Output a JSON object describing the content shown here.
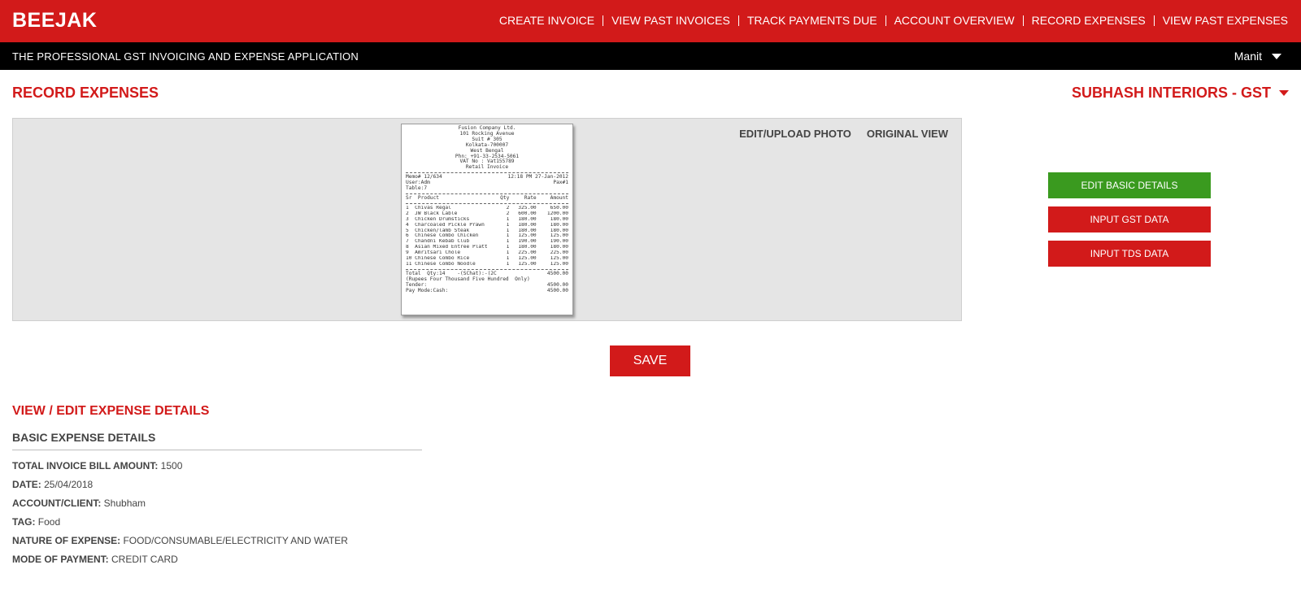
{
  "header": {
    "brand": "BEEJAK",
    "nav": [
      "CREATE INVOICE",
      "VIEW PAST INVOICES",
      "TRACK PAYMENTS DUE",
      "ACCOUNT OVERVIEW",
      "RECORD EXPENSES",
      "VIEW PAST EXPENSES"
    ],
    "tagline": "THE PROFESSIONAL GST INVOICING AND EXPENSE APPLICATION",
    "user": "Manit"
  },
  "page": {
    "title": "RECORD EXPENSES",
    "company": "SUBHASH INTERIORS - GST"
  },
  "photo": {
    "edit_upload": "EDIT/UPLOAD PHOTO",
    "original_view": "ORIGINAL VIEW",
    "receipt": {
      "header_lines": [
        "Fusion Company Ltd.",
        "101 Rocking Avenue",
        "Suit # 305",
        "Kolkata-700007",
        "West Bengal",
        "Phn: +91-33-2534-5061",
        "VAT No : Vat155789",
        "Retail Invoice"
      ],
      "memo": "Memo# 12/634",
      "datetime": "12:18 PM 27-Jan-2012",
      "user": "User:Adm",
      "station": "Pax#1",
      "table": "Table:7",
      "columns": [
        "Sr  Product",
        "Qty",
        "Rate",
        "Amount"
      ],
      "items": [
        [
          "1  Chivas Regal",
          "2",
          "325.00",
          "650.00"
        ],
        [
          "2  JW Black Lable",
          "2",
          "600.00",
          "1200.00"
        ],
        [
          "3  Chicken Drumsticks",
          "1",
          "180.00",
          "180.00"
        ],
        [
          "4  Charcoaled Pickle Prawn",
          "1",
          "180.00",
          "180.00"
        ],
        [
          "5  Chicken/lamb Steak",
          "1",
          "180.00",
          "180.00"
        ],
        [
          "6  Chinese Combo Chicken",
          "1",
          "125.00",
          "125.00"
        ],
        [
          "7  Chandni Kebab Club",
          "1",
          "190.00",
          "190.00"
        ],
        [
          "8  Asian Mixed Entree Platt",
          "1",
          "180.00",
          "180.00"
        ],
        [
          "9  Amritsari Chole",
          "1",
          "225.00",
          "225.00"
        ],
        [
          "10 Chinese Combo Rice",
          "1",
          "125.00",
          "125.00"
        ],
        [
          "11 Chinese Combo Noodle",
          "1",
          "125.00",
          "125.00"
        ]
      ],
      "total_label": "Total  Qty:14    -(SChat):-(2C",
      "total_value": "4500.00",
      "words": "(Rupees Four Thousand Five Hundred  Only)",
      "tender_label": "Tender:",
      "tender_value": "4500.00",
      "pay_label": "Pay Mode:Cash:",
      "pay_value": "4500.00"
    }
  },
  "actions": {
    "edit_basic": "EDIT BASIC DETAILS",
    "input_gst": "INPUT GST DATA",
    "input_tds": "INPUT TDS DATA",
    "save": "SAVE"
  },
  "details": {
    "section_title": "VIEW / EDIT EXPENSE DETAILS",
    "subsection_title": "BASIC EXPENSE DETAILS",
    "rows": [
      {
        "label": "TOTAL INVOICE BILL AMOUNT:",
        "value": "1500"
      },
      {
        "label": "DATE:",
        "value": "25/04/2018"
      },
      {
        "label": "ACCOUNT/CLIENT:",
        "value": "Shubham"
      },
      {
        "label": "TAG:",
        "value": "Food"
      },
      {
        "label": "NATURE OF EXPENSE:",
        "value": "FOOD/CONSUMABLE/ELECTRICITY AND WATER"
      },
      {
        "label": "MODE OF PAYMENT:",
        "value": "CREDIT CARD"
      }
    ]
  },
  "colors": {
    "brand_red": "#d21a1a",
    "green": "#3a9a1f",
    "black": "#000000"
  },
  "icons": {
    "user_menu": "chevron-down-icon",
    "company_menu": "chevron-down-icon"
  }
}
